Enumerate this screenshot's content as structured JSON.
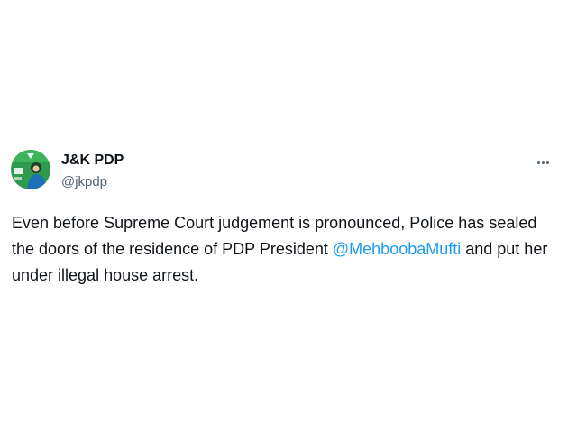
{
  "tweet": {
    "author": {
      "display_name": "J&K PDP",
      "handle": "@jkpdp",
      "avatar_icon": "profile-avatar-image"
    },
    "more_icon": "more-options-icon",
    "text_before": "Even before Supreme Court judgement is pronounced, Police has sealed the doors of the residence of PDP President ",
    "mention": "@MehboobaMufti",
    "text_after": " and put her under illegal house arrest."
  },
  "colors": {
    "text": "#0f1419",
    "secondary_text": "#536471",
    "link": "#1d9bf0",
    "avatar_background": "#2e9a4c"
  }
}
